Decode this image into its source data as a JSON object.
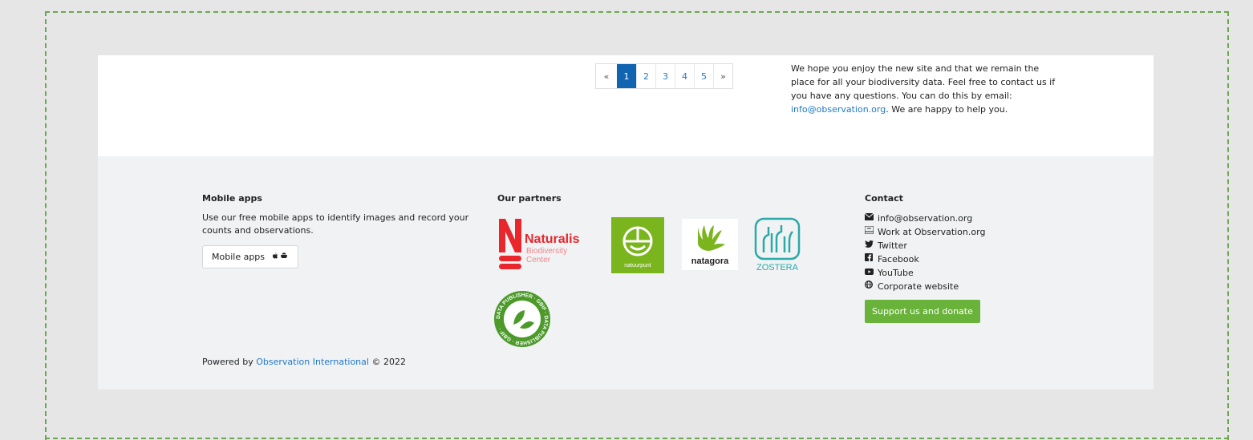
{
  "pagination": {
    "prev": "«",
    "pages": [
      "1",
      "2",
      "3",
      "4",
      "5"
    ],
    "next": "»",
    "active_page": "1"
  },
  "intro": {
    "text": "We hope you enjoy the new site and that we remain the place for all your biodiversity data. Feel free to contact us if you have any questions. You can do this by email:",
    "email": "info@observation.org",
    "closing": ". We are happy to help you."
  },
  "mobile": {
    "title": "Mobile apps",
    "desc": "Use our free mobile apps to identify images and record your counts and observations.",
    "button": "Mobile apps",
    "button_icons": "apple-and-android-icons"
  },
  "partners": {
    "title": "Our partners",
    "naturalis_name": "Naturalis",
    "naturalis_sub1": "Biodiversity",
    "naturalis_sub2": "Center",
    "natuurpunt": "natuurpunt",
    "natagora": "natagora",
    "zostera": "ZOSTERA",
    "gbif_ring": "DATA PUBLISHER · GBIF · DATA PUBLISHER · GBIF ·"
  },
  "contact": {
    "title": "Contact",
    "items": [
      {
        "icon": "envelope-icon",
        "label": "info@observation.org"
      },
      {
        "icon": "briefcase-icon",
        "label": "Work at Observation.org"
      },
      {
        "icon": "twitter-icon",
        "label": "Twitter"
      },
      {
        "icon": "facebook-icon",
        "label": "Facebook"
      },
      {
        "icon": "youtube-icon",
        "label": "YouTube"
      },
      {
        "icon": "globe-icon",
        "label": "Corporate website"
      }
    ],
    "donate": "Support us and donate"
  },
  "powered": {
    "prefix": "Powered by",
    "link": "Observation International",
    "suffix": "© 2022"
  },
  "colors": {
    "accent_blue": "#1064b0",
    "link_blue": "#1f78c8",
    "donate_green": "#69b33a",
    "frame_green": "#6aa84f",
    "naturalis_red": "#e8262b"
  }
}
